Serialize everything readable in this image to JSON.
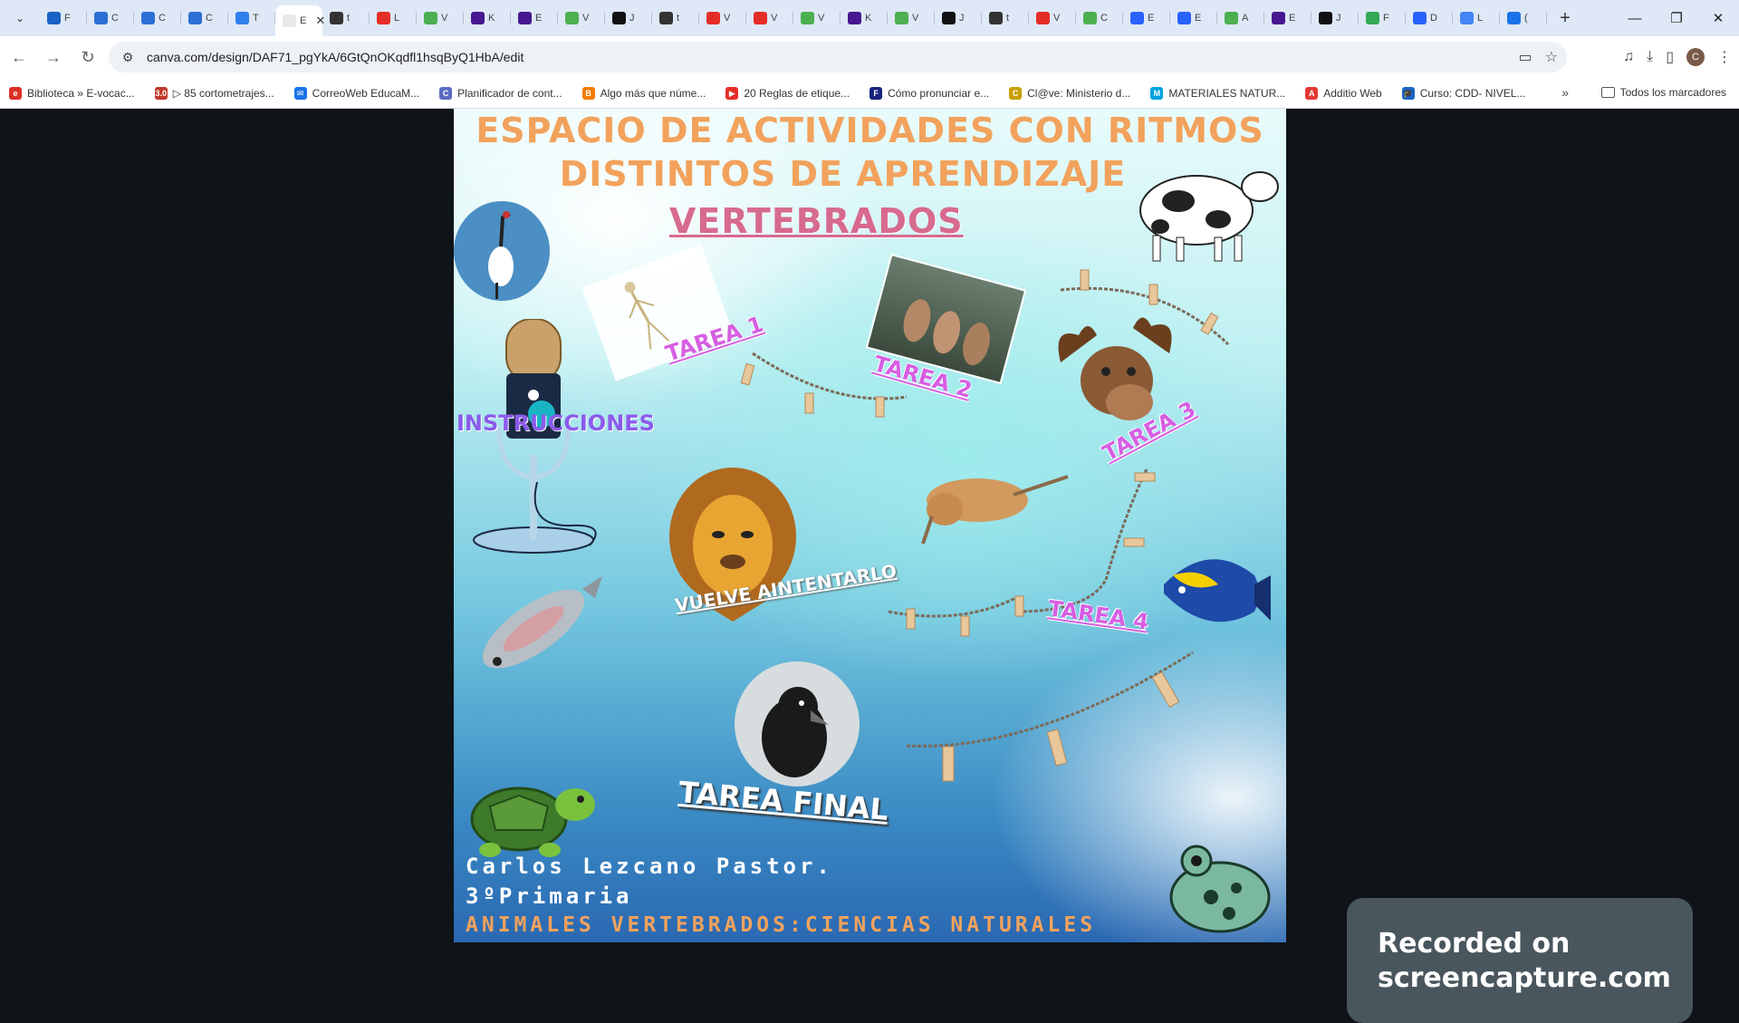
{
  "browser": {
    "tabs": [
      {
        "label": "F",
        "color": "#1a63c4",
        "glyph": "🎓"
      },
      {
        "label": "C",
        "color": "#2d6fd6"
      },
      {
        "label": "C",
        "color": "#2d6fd6"
      },
      {
        "label": "C",
        "color": "#2d6fd6"
      },
      {
        "label": "T",
        "color": "#2f80ed"
      },
      {
        "label": "E",
        "color": "#ffffff",
        "active": true
      },
      {
        "label": "t",
        "color": "#333333"
      },
      {
        "label": "L",
        "color": "#e52d27"
      },
      {
        "label": "V",
        "color": "#4caf50"
      },
      {
        "label": "K",
        "color": "#46178f"
      },
      {
        "label": "E",
        "color": "#46178f"
      },
      {
        "label": "V",
        "color": "#4caf50"
      },
      {
        "label": "J",
        "color": "#111111"
      },
      {
        "label": "t",
        "color": "#333333"
      },
      {
        "label": "V",
        "color": "#e52d27"
      },
      {
        "label": "V",
        "color": "#e52d27"
      },
      {
        "label": "V",
        "color": "#4caf50"
      },
      {
        "label": "K",
        "color": "#46178f"
      },
      {
        "label": "V",
        "color": "#4caf50"
      },
      {
        "label": "J",
        "color": "#111111"
      },
      {
        "label": "t",
        "color": "#333333"
      },
      {
        "label": "V",
        "color": "#e52d27"
      },
      {
        "label": "C",
        "color": "#4caf50"
      },
      {
        "label": "E",
        "color": "#2962ff"
      },
      {
        "label": "E",
        "color": "#2962ff"
      },
      {
        "label": "A",
        "color": "#4caf50"
      },
      {
        "label": "E",
        "color": "#46178f"
      },
      {
        "label": "J",
        "color": "#111111"
      },
      {
        "label": "F",
        "color": "#34a853"
      },
      {
        "label": "D",
        "color": "#2962ff"
      },
      {
        "label": "L",
        "color": "#4285f4"
      },
      {
        "label": "(",
        "color": "#1a73e8"
      }
    ],
    "url": "canva.com/design/DAF71_pgYkA/6GtQnOKqdfl1hsqByQ1HbA/edit",
    "profile_initial": "C",
    "bookmarks": [
      {
        "label": "Biblioteca » E-vocac...",
        "color": "#d93025",
        "glyph": "e"
      },
      {
        "label": "▷ 85 cortometrajes...",
        "color": "#c0392b",
        "glyph": "3.0"
      },
      {
        "label": "CorreoWeb EducaM...",
        "color": "#1a73e8",
        "glyph": "✉"
      },
      {
        "label": "Planificador de cont...",
        "color": "#5b6bc0",
        "glyph": "C"
      },
      {
        "label": "Algo más que núme...",
        "color": "#f57c00",
        "glyph": "B"
      },
      {
        "label": "20 Reglas de etique...",
        "color": "#e52d27",
        "glyph": "▶"
      },
      {
        "label": "Cómo pronunciar e...",
        "color": "#1a237e",
        "glyph": "F"
      },
      {
        "label": "Cl@ve: Ministerio d...",
        "color": "#c8a000",
        "glyph": "C"
      },
      {
        "label": "MATERIALES NATUR...",
        "color": "#00a3e0",
        "glyph": "M"
      },
      {
        "label": "Additio Web",
        "color": "#e53935",
        "glyph": "A"
      },
      {
        "label": "Curso: CDD- NIVEL...",
        "color": "#1a63c4",
        "glyph": "🎓"
      }
    ],
    "all_bookmarks": "Todos los marcadores"
  },
  "poster": {
    "title_line1": "ESPACIO DE ACTIVIDADES CON RITMOS",
    "title_line2": "DISTINTOS DE APRENDIZAJE",
    "subtitle": "VERTEBRADOS",
    "instructions": "INSTRUCCIONES",
    "task1": "TAREA 1",
    "task2": "TAREA 2",
    "task3": "TAREA 3",
    "task4": "TAREA 4",
    "retry": "VUELVE AINTENTARLO",
    "final_task": "TAREA FINAL",
    "author": "Carlos Lezcano Pastor.",
    "grade": "3ºPrimaria",
    "topic": "ANIMALES VERTEBRADOS:CIENCIAS NATURALES"
  },
  "watermark": {
    "line1": "Recorded on",
    "line2": "screencapture.com"
  }
}
